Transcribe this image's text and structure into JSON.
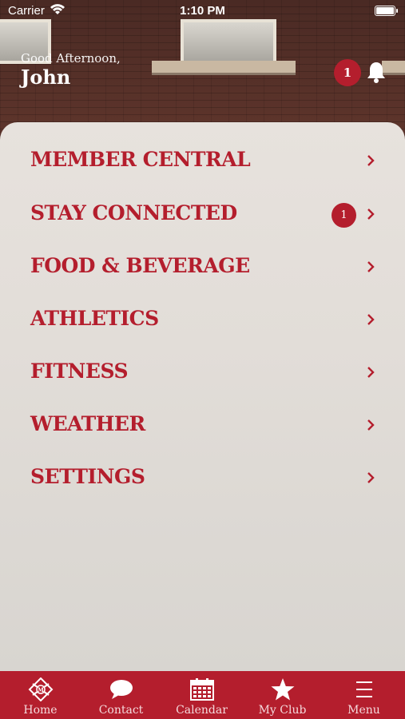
{
  "status_bar": {
    "carrier": "Carrier",
    "time": "1:10 PM"
  },
  "header": {
    "greeting": "Good Afternoon,",
    "user_name": "John",
    "notification_count": "1"
  },
  "menu": {
    "items": [
      {
        "label": "MEMBER CENTRAL",
        "badge": ""
      },
      {
        "label": "STAY CONNECTED",
        "badge": "1"
      },
      {
        "label": "FOOD & BEVERAGE",
        "badge": ""
      },
      {
        "label": "ATHLETICS",
        "badge": ""
      },
      {
        "label": "FITNESS",
        "badge": ""
      },
      {
        "label": "WEATHER",
        "badge": ""
      },
      {
        "label": "SETTINGS",
        "badge": ""
      }
    ]
  },
  "tabbar": {
    "tabs": [
      {
        "label": "Home",
        "icon": "home-logo-icon"
      },
      {
        "label": "Contact",
        "icon": "chat-bubble-icon"
      },
      {
        "label": "Calendar",
        "icon": "calendar-icon"
      },
      {
        "label": "My Club",
        "icon": "star-icon"
      },
      {
        "label": "Menu",
        "icon": "hamburger-icon"
      }
    ]
  },
  "colors": {
    "accent": "#b41e2d",
    "card": "#e4dfda",
    "text_light": "#ffffff"
  }
}
